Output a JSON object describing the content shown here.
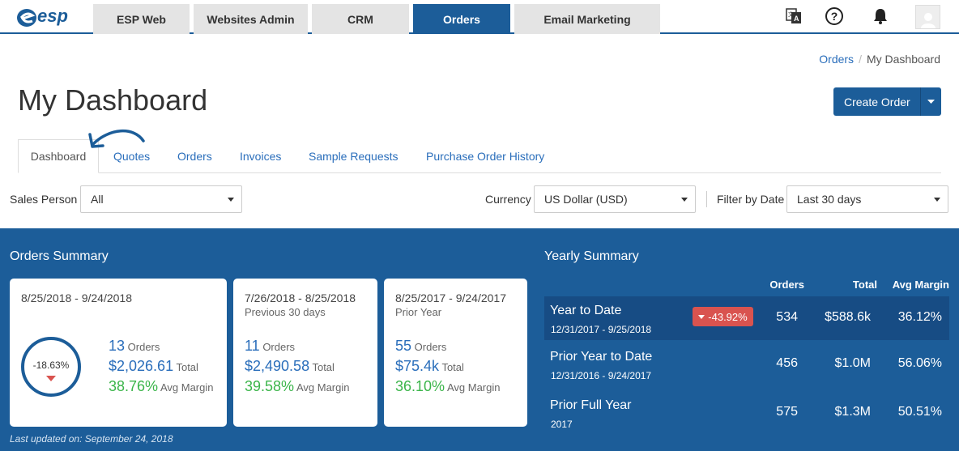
{
  "nav": {
    "tabs": [
      {
        "label": "ESP Web",
        "active": false
      },
      {
        "label": "Websites Admin",
        "active": false
      },
      {
        "label": "CRM",
        "active": false
      },
      {
        "label": "Orders",
        "active": true
      },
      {
        "label": "Email Marketing",
        "active": false
      }
    ],
    "icons": [
      "translate-icon",
      "help-icon",
      "bell-icon",
      "avatar-icon"
    ]
  },
  "breadcrumb": {
    "parent": "Orders",
    "current": "My Dashboard"
  },
  "page": {
    "title": "My Dashboard",
    "create_button": "Create Order"
  },
  "tabs": [
    "Dashboard",
    "Quotes",
    "Orders",
    "Invoices",
    "Sample Requests",
    "Purchase Order History"
  ],
  "filters": {
    "sales_person_label": "Sales Person",
    "sales_person_value": "All",
    "currency_label": "Currency",
    "currency_value": "US Dollar (USD)",
    "date_label": "Filter by Date",
    "date_value": "Last 30 days"
  },
  "orders_summary": {
    "title": "Orders Summary",
    "cards": [
      {
        "range": "8/25/2018 - 9/24/2018",
        "sub": "",
        "change": "-18.63%",
        "orders": "13",
        "total": "$2,026.61",
        "margin": "38.76%"
      },
      {
        "range": "7/26/2018 - 8/25/2018",
        "sub": "Previous 30 days",
        "orders": "11",
        "total": "$2,490.58",
        "margin": "39.58%"
      },
      {
        "range": "8/25/2017 - 9/24/2017",
        "sub": "Prior Year",
        "orders": "55",
        "total": "$75.4k",
        "margin": "36.10%"
      }
    ],
    "orders_label": "Orders",
    "total_label": "Total",
    "margin_label": "Avg Margin",
    "updated": "Last updated on: September 24, 2018"
  },
  "yearly_summary": {
    "title": "Yearly Summary",
    "headers": {
      "orders": "Orders",
      "total": "Total",
      "margin": "Avg Margin"
    },
    "rows": [
      {
        "label": "Year to Date",
        "dates": "12/31/2017 - 9/25/2018",
        "badge": "-43.92%",
        "orders": "534",
        "total": "$588.6k",
        "margin": "36.12%"
      },
      {
        "label": "Prior Year to Date",
        "dates": "12/31/2016 - 9/24/2017",
        "orders": "456",
        "total": "$1.0M",
        "margin": "56.06%"
      },
      {
        "label": "Prior Full Year",
        "dates": "2017",
        "orders": "575",
        "total": "$1.3M",
        "margin": "50.51%"
      }
    ]
  },
  "colors": {
    "primary": "#1c5d99",
    "link": "#2a6ebb",
    "positive": "#3bb54a",
    "negative": "#d9534f"
  }
}
